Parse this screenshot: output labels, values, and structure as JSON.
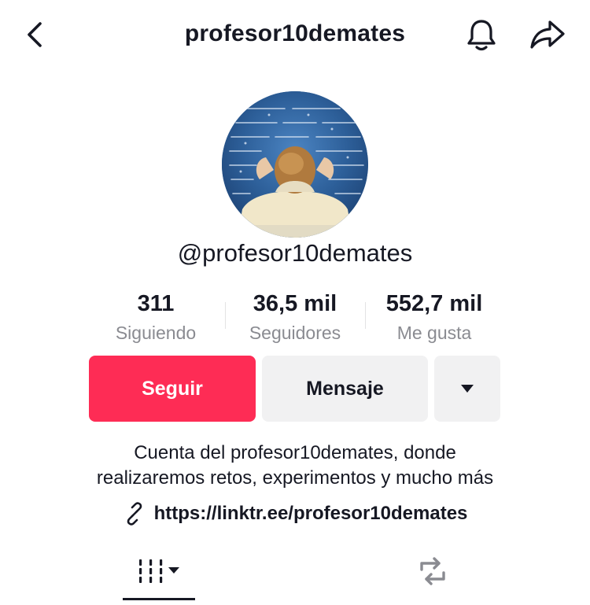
{
  "header": {
    "title": "profesor10demates",
    "back_icon": "chevron-left-icon",
    "notification_icon": "bell-icon",
    "share_icon": "share-arrow-icon"
  },
  "profile": {
    "avatar": "profile-photo",
    "handle": "@profesor10demates"
  },
  "stats": [
    {
      "value": "311",
      "label": "Siguiendo"
    },
    {
      "value": "36,5 mil",
      "label": "Seguidores"
    },
    {
      "value": "552,7 mil",
      "label": "Me gusta"
    }
  ],
  "actions": {
    "follow_label": "Seguir",
    "message_label": "Mensaje",
    "more_icon": "caret-down-icon"
  },
  "bio": {
    "line1": "Cuenta del profesor10demates, donde",
    "line2": "realizaremos retos, experimentos y mucho más"
  },
  "link": {
    "icon": "link-icon",
    "text": "https://linktr.ee/profesor10demates"
  },
  "tabs": [
    {
      "name": "videos-grid",
      "icon": "grid-icon",
      "active": true
    },
    {
      "name": "reposts",
      "icon": "repost-icon",
      "active": false
    }
  ],
  "colors": {
    "accent": "#fe2c55",
    "secondary_button": "#f1f1f2",
    "text_primary": "#161823",
    "text_secondary": "#8a8b91"
  }
}
